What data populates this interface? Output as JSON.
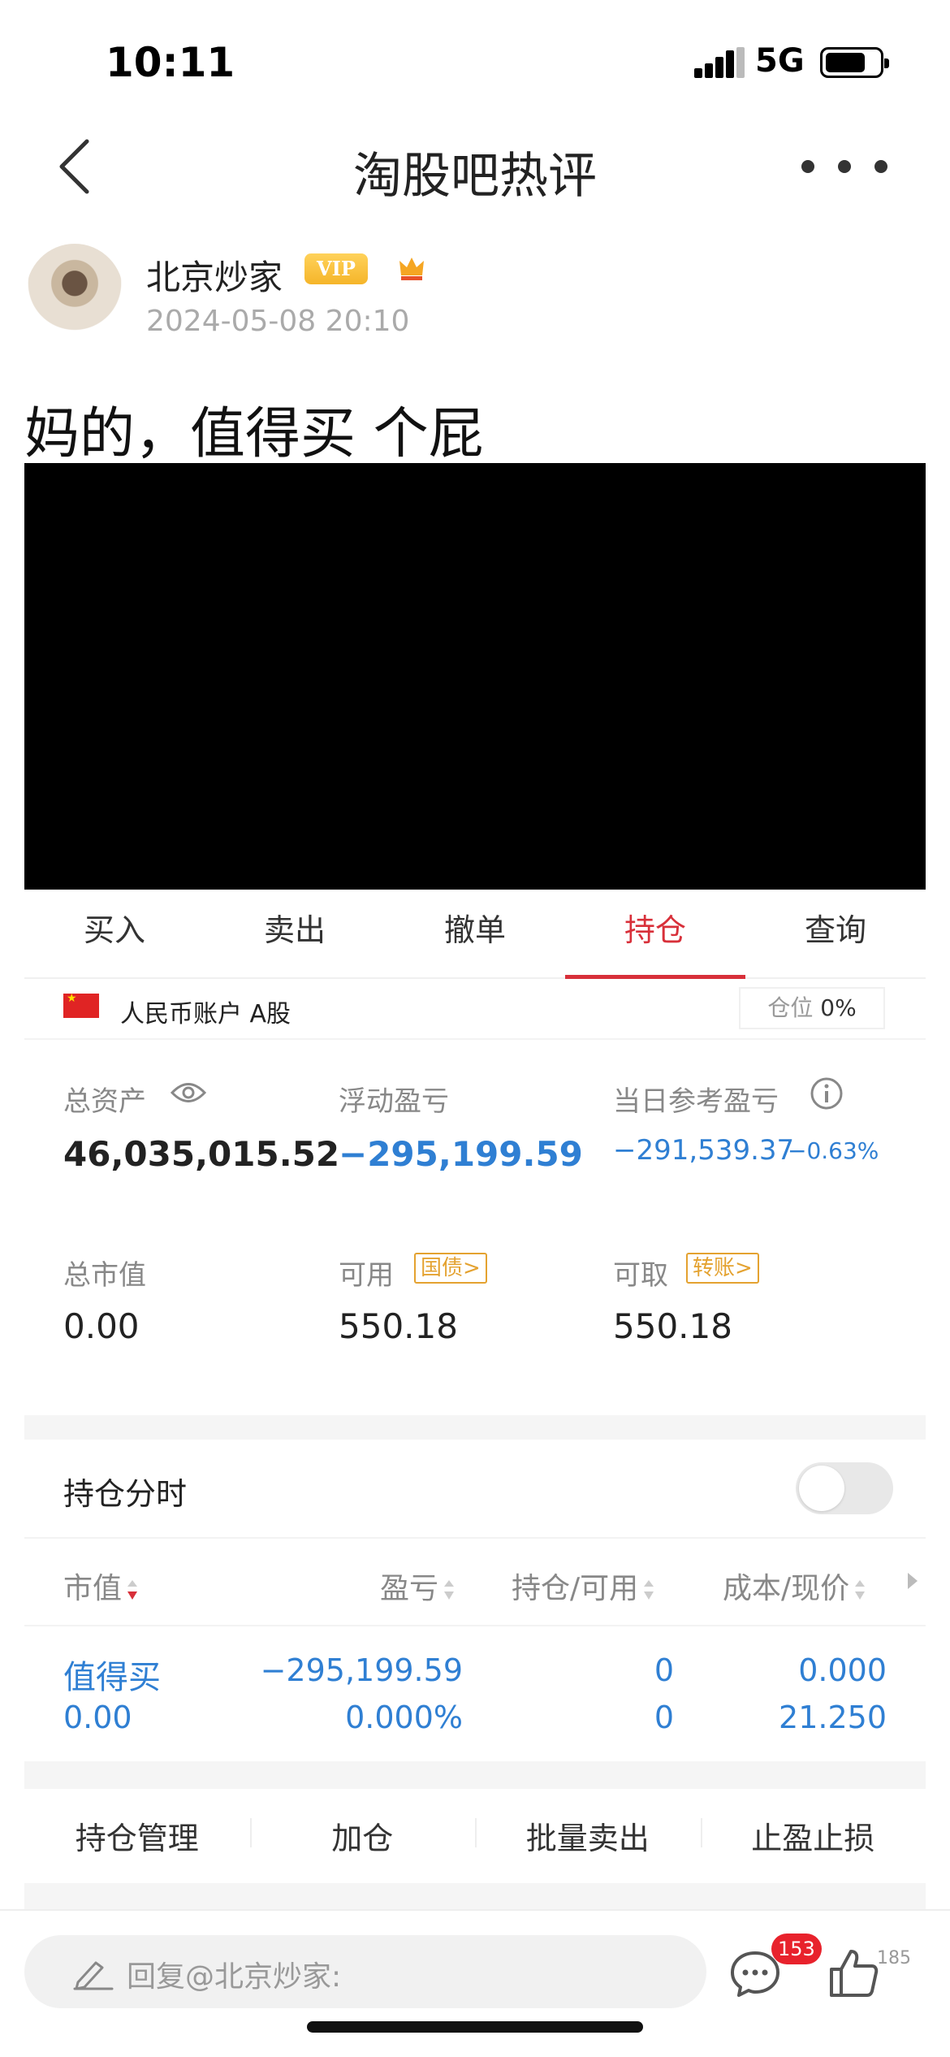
{
  "status_bar": {
    "time": "10:11",
    "network": "5G",
    "battery_level": 0.75
  },
  "nav": {
    "title": "淘股吧热评"
  },
  "post": {
    "author": "北京炒家",
    "vip": "VIP",
    "date": "2024-05-08 20:10",
    "text_before": "妈的，",
    "stock_link": "值得买",
    "text_after": " 个屁"
  },
  "trade": {
    "tabs": [
      "买入",
      "卖出",
      "撤单",
      "持仓",
      "查询"
    ],
    "active_tab": "持仓",
    "account_label": "人民币账户 A股",
    "position_label": "仓位",
    "position_value": "0%",
    "total_assets_label": "总资产",
    "total_assets": "46,035,015.52",
    "float_pl_label": "浮动盈亏",
    "float_pl": "−295,199.59",
    "daily_pl_label": "当日参考盈亏",
    "daily_pl": "−291,539.37",
    "daily_pl_pct": "−0.63%",
    "market_value_label": "总市值",
    "market_value": "0.00",
    "available_label": "可用",
    "available_link": "国债>",
    "available": "550.18",
    "withdrawable_label": "可取",
    "withdrawable_link": "转账>",
    "withdrawable": "550.18",
    "split_label": "持仓分时",
    "columns": [
      "市值",
      "盈亏",
      "持仓/可用",
      "成本/现价"
    ],
    "holding": {
      "name": "值得买",
      "market_value": "0.00",
      "pl": "−295,199.59",
      "pl_pct": "0.000%",
      "position": "0",
      "available": "0",
      "cost": "0.000",
      "price": "21.250"
    },
    "actions": [
      "持仓管理",
      "加仓",
      "批量卖出",
      "止盈止损"
    ]
  },
  "reply": {
    "placeholder": "回复@北京炒家:",
    "comment_count": "153",
    "like_count": "185"
  }
}
